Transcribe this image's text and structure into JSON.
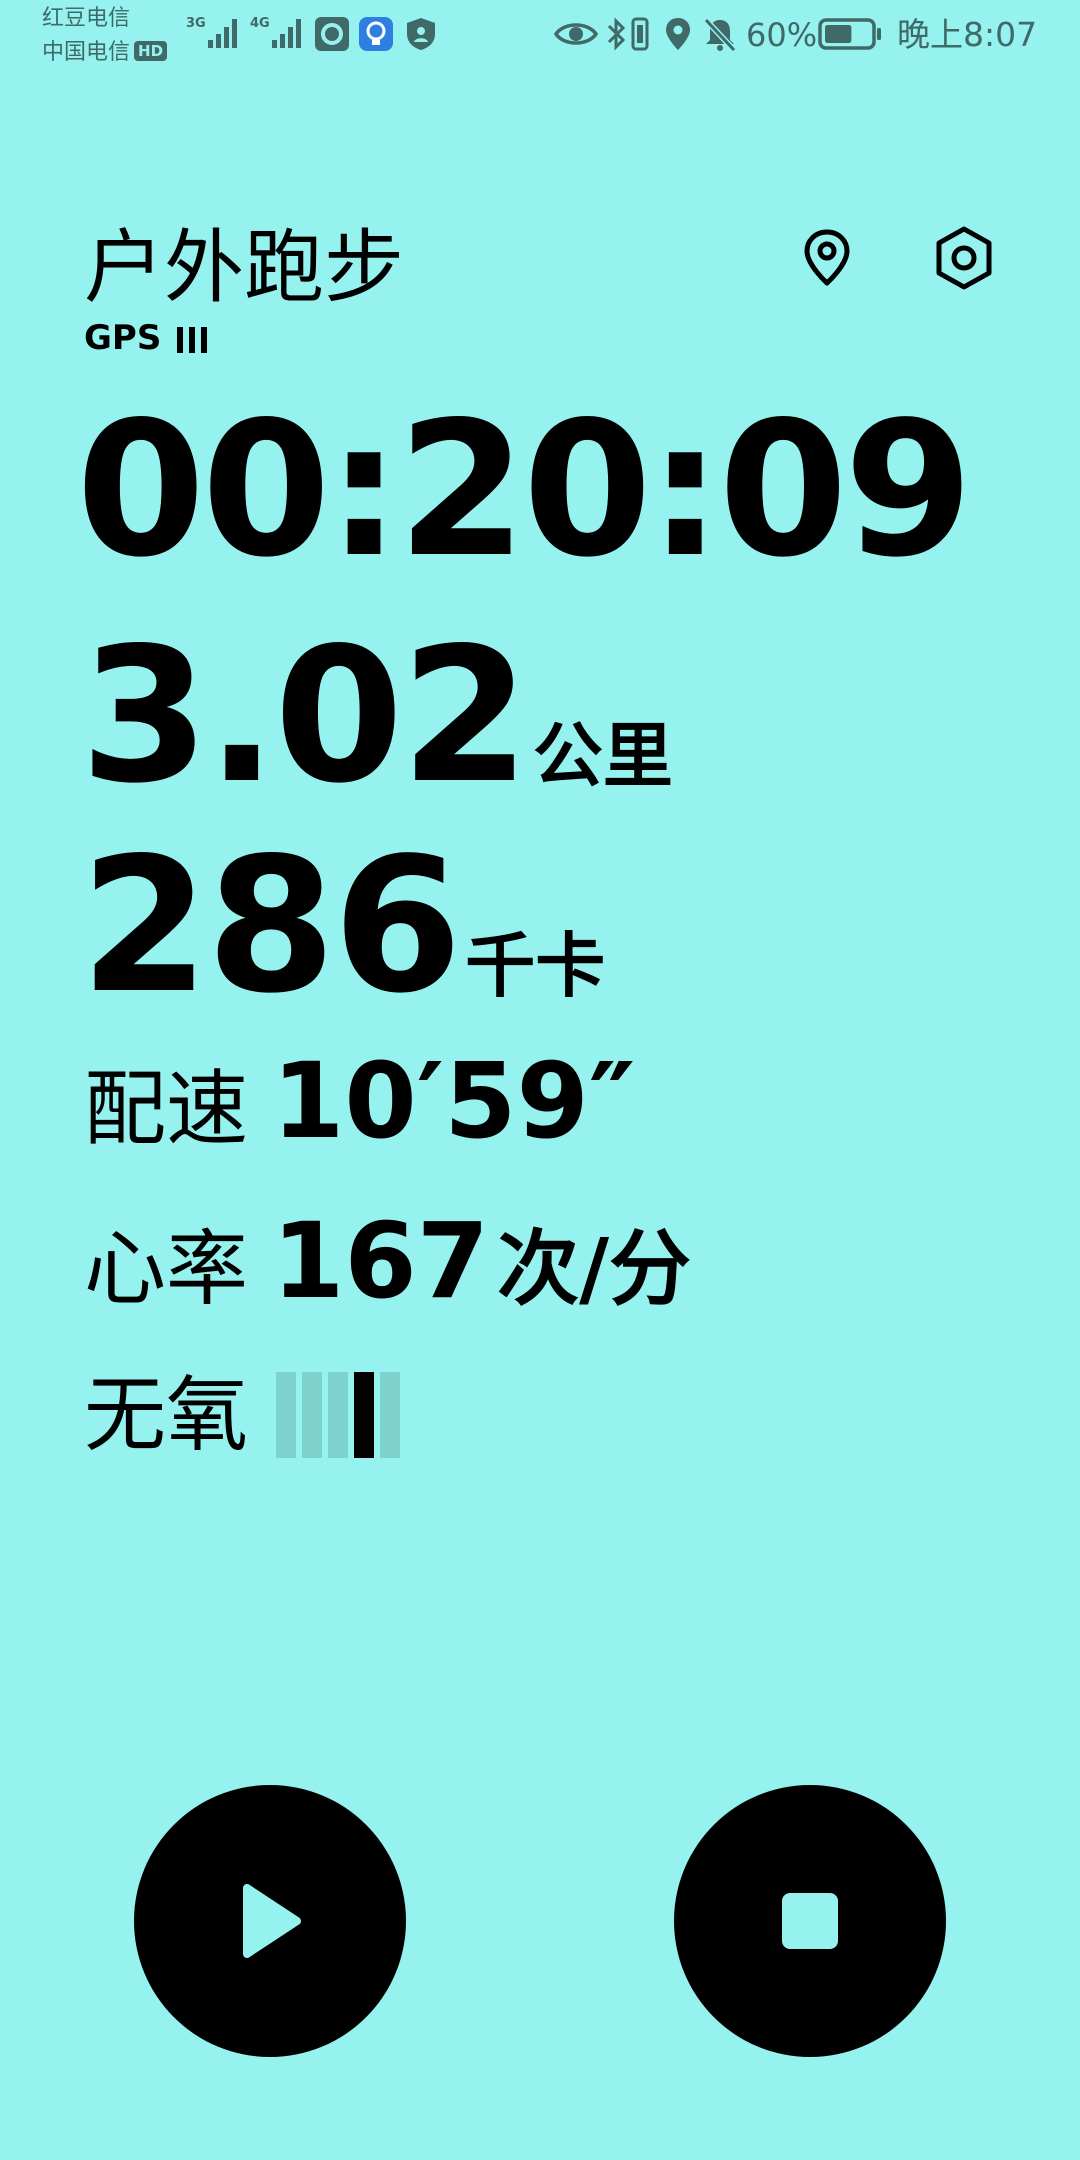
{
  "status_bar": {
    "carrier1": "红豆电信",
    "carrier2": "中国电信",
    "hd_badge": "HD",
    "net1": "3G",
    "net2": "4G",
    "battery_percent": "60%",
    "battery_level": 0.6,
    "time": "晚上8:07",
    "icons": [
      "signal-3g-icon",
      "signal-4g-icon",
      "camera-app-icon",
      "bulb-app-icon",
      "shield-icon",
      "eye-icon",
      "bluetooth-icon",
      "vibrate-icon",
      "location-icon",
      "mute-icon",
      "battery-icon"
    ]
  },
  "header": {
    "title": "户外跑步",
    "gps_label": "GPS",
    "gps_signal_bars": 3,
    "location_icon": "map-pin-icon",
    "settings_icon": "settings-hexagon-icon"
  },
  "workout": {
    "elapsed_time": "00:20:09",
    "distance": {
      "value": "3.02",
      "unit": "公里"
    },
    "calories": {
      "value": "286",
      "unit": "千卡"
    },
    "pace": {
      "label": "配速",
      "value": "10′59″"
    },
    "heart_rate": {
      "label": "心率",
      "value": "167",
      "unit": "次/分"
    },
    "zone": {
      "label": "无氧",
      "total_levels": 5,
      "active_level": 4
    }
  },
  "controls": {
    "play_icon": "play-icon",
    "stop_icon": "stop-icon"
  },
  "colors": {
    "background": "#96f2ee",
    "foreground": "#000000",
    "status_text": "#3f6a68",
    "zone_inactive": "#7ed2ce"
  }
}
